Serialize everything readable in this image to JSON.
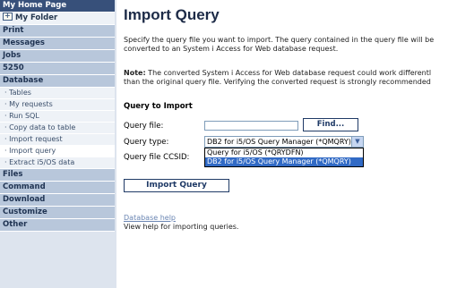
{
  "sidebar": {
    "home": "My Home Page",
    "my_folder": "My Folder",
    "print": "Print",
    "messages": "Messages",
    "jobs": "Jobs",
    "s5250": "5250",
    "database": "Database",
    "db_items": [
      "Tables",
      "My requests",
      "Run SQL",
      "Copy data to table",
      "Import request",
      "Import query",
      "Extract i5/OS data"
    ],
    "files": "Files",
    "command": "Command",
    "download": "Download",
    "customize": "Customize",
    "other": "Other"
  },
  "main": {
    "title": "Import Query",
    "intro_line1": "Specify the query file you want to import. The query contained in the query file will be",
    "intro_line2": "converted to an System i Access for Web database request.",
    "note_label": "Note:",
    "note_line1": " The converted System i Access for Web database request could work differentl",
    "note_line2": "than the original query file. Verifying the converted request is strongly recommended",
    "section_heading": "Query to Import",
    "query_file_label": "Query file:",
    "query_file_value": "",
    "find_button": "Find...",
    "query_type_label": "Query type:",
    "query_type_selected": "DB2 for i5/OS Query Manager (*QMQRY)",
    "query_type_options": [
      "Query for i5/OS (*QRYDFN)",
      "DB2 for i5/OS Query Manager (*QMQRY)"
    ],
    "ccsid_label": "Query file CCSID:",
    "import_button": "Import Query",
    "help_link": "Database help",
    "help_desc": "View help for importing queries."
  }
}
